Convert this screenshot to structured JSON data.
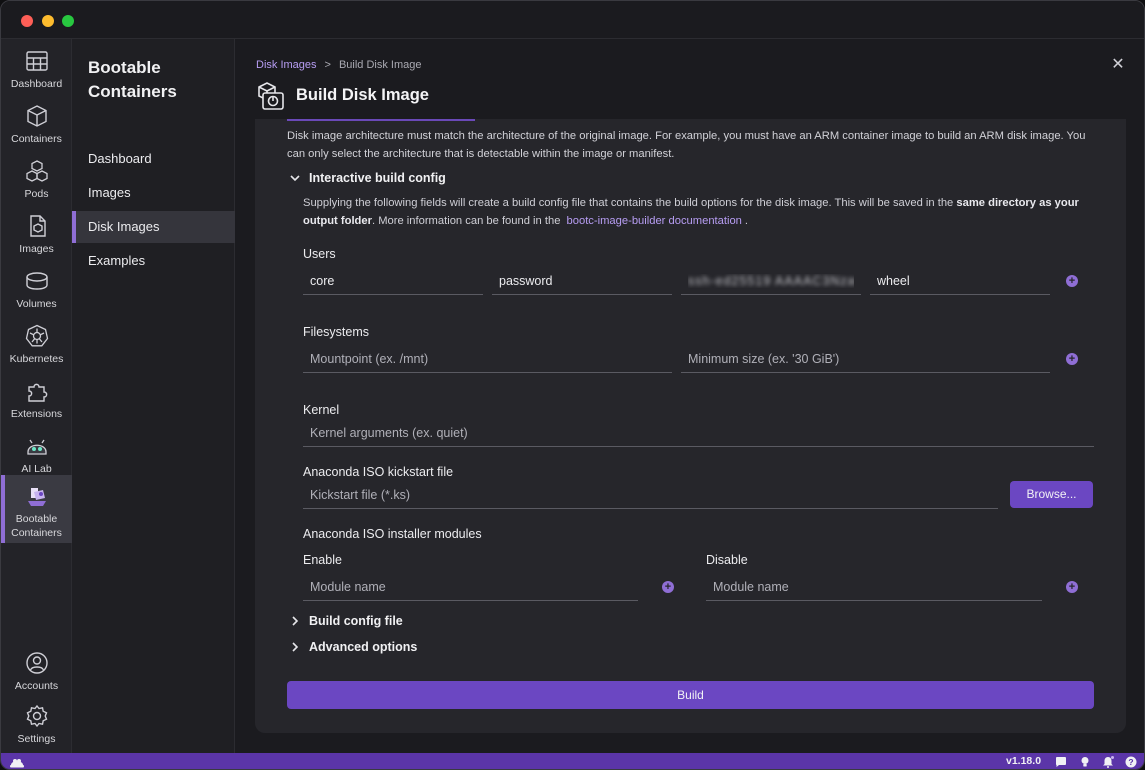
{
  "rail": {
    "items": [
      {
        "label": "Dashboard",
        "icon": "dashboard-icon"
      },
      {
        "label": "Containers",
        "icon": "containers-icon"
      },
      {
        "label": "Pods",
        "icon": "pods-icon"
      },
      {
        "label": "Images",
        "icon": "images-icon"
      },
      {
        "label": "Volumes",
        "icon": "volumes-icon"
      },
      {
        "label": "Kubernetes",
        "icon": "kubernetes-icon"
      },
      {
        "label": "Extensions",
        "icon": "extensions-icon"
      },
      {
        "label": "AI Lab",
        "icon": "ai-lab-icon"
      },
      {
        "label": "Bootable Containers",
        "icon": "bootable-containers-icon"
      },
      {
        "label": "Accounts",
        "icon": "accounts-icon"
      },
      {
        "label": "Settings",
        "icon": "settings-icon"
      }
    ]
  },
  "subnav": {
    "title": "Bootable Containers",
    "items": [
      "Dashboard",
      "Images",
      "Disk Images",
      "Examples"
    ],
    "active": "Disk Images"
  },
  "header": {
    "breadcrumb_link": "Disk Images",
    "breadcrumb_sep": ">",
    "breadcrumb_current": "Build Disk Image",
    "title": "Build Disk Image",
    "close": "✕"
  },
  "form": {
    "arch_note": "Disk image architecture must match the architecture of the original image. For example, you must have an ARM container image to build an ARM disk image. You can only select the architecture that is detectable within the image or manifest.",
    "interactive_section": "Interactive build config",
    "desc_part1": "Supplying the following fields will create a build config file that contains the build options for the disk image. This will be saved in the",
    "desc_bold": "same directory as your output folder",
    "desc_part2": ". More information can be found in the",
    "desc_link": "bootc-image-builder documentation",
    "desc_end": ".",
    "users_label": "Users",
    "user_name": "core",
    "user_password": "password",
    "user_key": "ssh-ed25519 AAAAC3NzaC1",
    "user_groups": "wheel",
    "filesystems_label": "Filesystems",
    "mountpoint_placeholder": "Mountpoint (ex. /mnt)",
    "minsize_placeholder": "Minimum size (ex. '30 GiB')",
    "kernel_label": "Kernel",
    "kernel_placeholder": "Kernel arguments (ex. quiet)",
    "kickstart_label": "Anaconda ISO kickstart file",
    "kickstart_placeholder": "Kickstart file (*.ks)",
    "browse_label": "Browse...",
    "modules_label": "Anaconda ISO installer modules",
    "enable_label": "Enable",
    "disable_label": "Disable",
    "module_placeholder": "Module name",
    "build_config_section": "Build config file",
    "advanced_section": "Advanced options",
    "build_label": "Build"
  },
  "status": {
    "version": "v1.18.0"
  },
  "colors": {
    "accent": "#8f6ed5",
    "button": "#6b47c2",
    "statusbar": "#5b35a8"
  }
}
